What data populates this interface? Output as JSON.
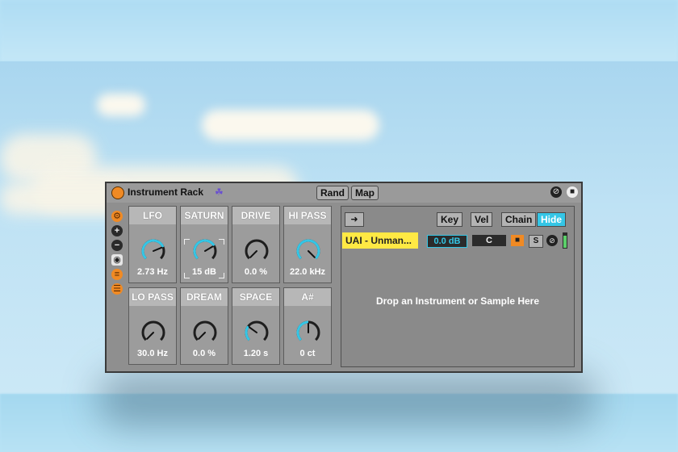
{
  "rack": {
    "title": "Instrument Rack",
    "rand_label": "Rand",
    "map_label": "Map"
  },
  "macros": [
    {
      "label": "LFO",
      "value": "2.73 Hz",
      "level": 0.75
    },
    {
      "label": "SATURN",
      "value": "15 dB",
      "level": 0.72
    },
    {
      "label": "DRIVE",
      "value": "0.0 %",
      "level": 0.0
    },
    {
      "label": "HI PASS",
      "value": "22.0 kHz",
      "level": 1.0
    },
    {
      "label": "LO PASS",
      "value": "30.0 Hz",
      "level": 0.0
    },
    {
      "label": "DREAM",
      "value": "0.0 %",
      "level": 0.0
    },
    {
      "label": "SPACE",
      "value": "1.20 s",
      "level": 0.3
    },
    {
      "label": "A#",
      "value": "0 ct",
      "level": 0.5
    }
  ],
  "chain_list": {
    "key_label": "Key",
    "vel_label": "Vel",
    "chain_label": "Chain",
    "hide_label": "Hide",
    "chain_name": "UAI - Unman...",
    "volume": "0.0 dB",
    "pan": "C",
    "solo_label": "S",
    "drop_text": "Drop an Instrument or Sample Here"
  },
  "colors": {
    "accent_orange": "#f08a24",
    "accent_cyan": "#34c6e6",
    "chain_yellow": "#ffe944"
  }
}
